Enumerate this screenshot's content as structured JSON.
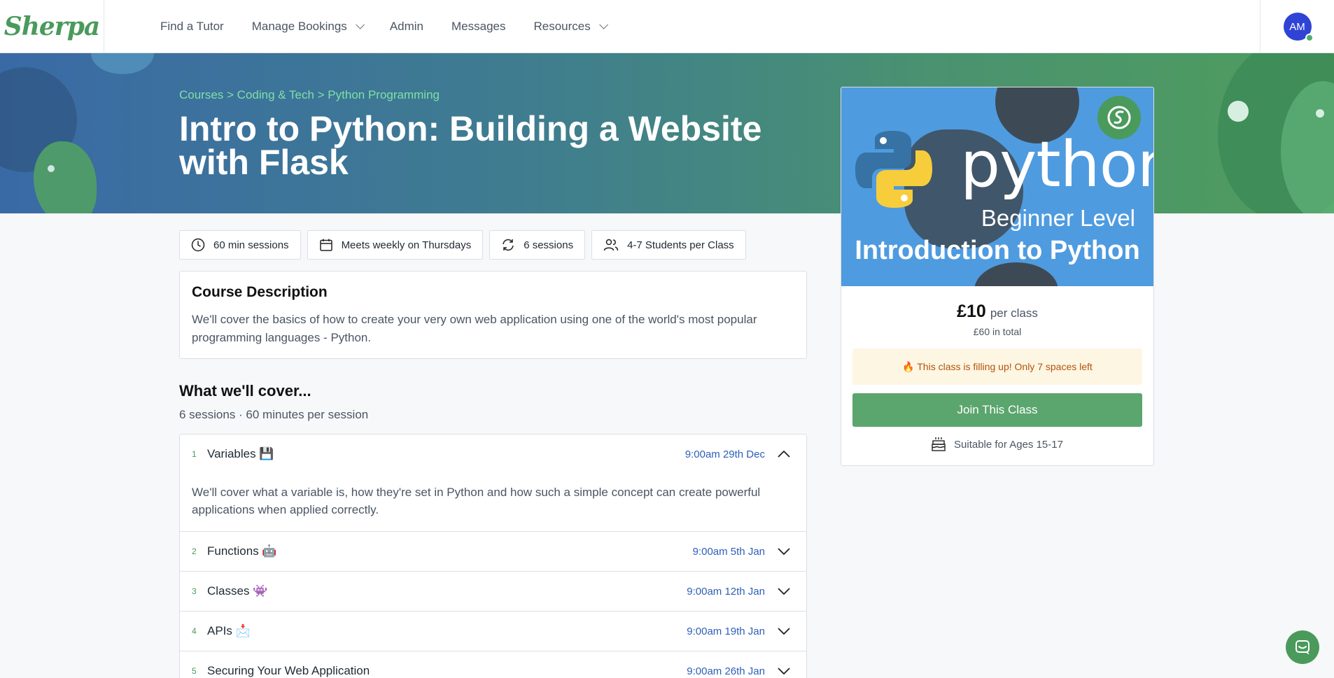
{
  "nav": {
    "logo": "Sherpa",
    "links": [
      {
        "label": "Find a Tutor",
        "dropdown": false
      },
      {
        "label": "Manage Bookings",
        "dropdown": true
      },
      {
        "label": "Admin",
        "dropdown": false
      },
      {
        "label": "Messages",
        "dropdown": false
      },
      {
        "label": "Resources",
        "dropdown": true
      }
    ],
    "avatar_initials": "AM"
  },
  "hero": {
    "breadcrumb": "Courses > Coding & Tech > Python Programming",
    "title": "Intro to Python: Building a Website with Flask"
  },
  "chips": [
    {
      "icon": "clock-icon",
      "label": "60 min sessions"
    },
    {
      "icon": "calendar-icon",
      "label": "Meets weekly on Thursdays"
    },
    {
      "icon": "repeat-icon",
      "label": "6 sessions"
    },
    {
      "icon": "users-icon",
      "label": "4-7 Students per Class"
    }
  ],
  "description": {
    "heading": "Course Description",
    "text": "We'll cover the basics of how to create your very own web application using one of the world's most popular programming languages - Python."
  },
  "cover": {
    "heading": "What we'll cover...",
    "subtitle": "6 sessions · 60 minutes per session"
  },
  "sessions": [
    {
      "num": "1",
      "title": "Variables 💾",
      "date": "9:00am 29th Dec",
      "expanded": true,
      "body": "We'll cover what a variable is, how they're set in Python and how such a simple concept can create powerful applications when applied correctly."
    },
    {
      "num": "2",
      "title": "Functions 🤖",
      "date": "9:00am 5th Jan",
      "expanded": false
    },
    {
      "num": "3",
      "title": "Classes 👾",
      "date": "9:00am 12th Jan",
      "expanded": false
    },
    {
      "num": "4",
      "title": "APIs 📩",
      "date": "9:00am 19th Jan",
      "expanded": false
    },
    {
      "num": "5",
      "title": "Securing Your Web Application",
      "date": "9:00am 26th Jan",
      "expanded": false
    }
  ],
  "card": {
    "image_word": "python",
    "image_level": "Beginner Level",
    "image_title": "Introduction to Python",
    "price": "£10",
    "price_unit": "per class",
    "total": "£60 in total",
    "alert": "🔥 This class is filling up! Only 7 spaces left",
    "join_label": "Join This Class",
    "ages": "Suitable for Ages 15-17"
  },
  "colors": {
    "brand_green": "#4a9a5c",
    "join_green": "#5ba56e",
    "link_blue": "#2d5fb8",
    "avatar_blue": "#2f43d6"
  }
}
